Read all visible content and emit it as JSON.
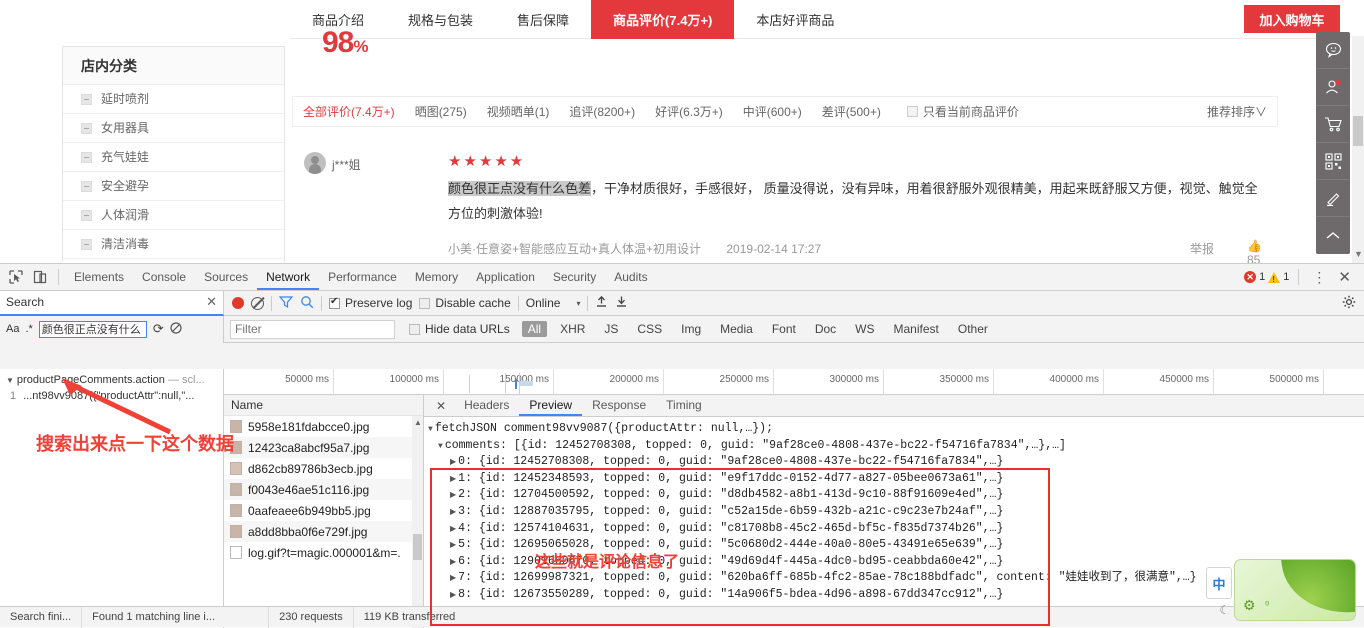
{
  "page": {
    "nav_tabs": [
      {
        "label": "商品介绍",
        "active": false
      },
      {
        "label": "规格与包装",
        "active": false
      },
      {
        "label": "售后保障",
        "active": false
      },
      {
        "label": "商品评价(7.4万+)",
        "active": true
      },
      {
        "label": "本店好评商品",
        "active": false
      }
    ],
    "cart_button": "加入购物车",
    "percent_value": "98",
    "percent_unit": "%",
    "category_box": {
      "title": "店内分类",
      "items": [
        "延时喷剂",
        "女用器具",
        "充气娃娃",
        "安全避孕",
        "人体润滑",
        "清洁消毒"
      ]
    },
    "review_filters": [
      {
        "label": "全部评价(7.4万+)",
        "active": true
      },
      {
        "label": "晒图(275)",
        "active": false
      },
      {
        "label": "视频晒单(1)",
        "active": false
      },
      {
        "label": "追评(8200+)",
        "active": false
      },
      {
        "label": "好评(6.3万+)",
        "active": false
      },
      {
        "label": "中评(600+)",
        "active": false
      },
      {
        "label": "差评(500+)",
        "active": false
      }
    ],
    "only_current_label": "只看当前商品评价",
    "sort_label": "推荐排序",
    "sort_caret": "∨",
    "review": {
      "username": "j***姐",
      "stars": "★★★★★",
      "highlight_text": "颜色很正点没有什么色差",
      "body_text": "，干净材质很好，手感很好， 质量没得说，没有异味，用着很舒服外观很精美，用起来既舒服又方便，视觉、触觉全方位的刺激体验!",
      "sku": "小美·任意姿+智能感应互动+真人体温+初用设计",
      "date": "2019-02-14 17:27",
      "report_label": "举报",
      "like_icon": "👍",
      "like_count": "85"
    },
    "side_toolbar_icons": [
      "chat-icon",
      "person-icon",
      "cart-icon",
      "qrcode-icon",
      "pen-icon",
      "scroll-top-icon"
    ]
  },
  "devtools": {
    "panel_tabs": [
      {
        "label": "Elements",
        "active": false
      },
      {
        "label": "Console",
        "active": false
      },
      {
        "label": "Sources",
        "active": false
      },
      {
        "label": "Network",
        "active": true
      },
      {
        "label": "Performance",
        "active": false
      },
      {
        "label": "Memory",
        "active": false
      },
      {
        "label": "Application",
        "active": false
      },
      {
        "label": "Security",
        "active": false
      },
      {
        "label": "Audits",
        "active": false
      }
    ],
    "error_count": "1",
    "warning_count": "1",
    "kebab": "⋮",
    "close": "✕",
    "search_panel": {
      "title": "Search",
      "close": "✕",
      "match_case_label": "Aa",
      "regex_label": ".*",
      "query_value": "颜色很正点没有什么",
      "refresh_icon": "⟳",
      "clear_icon": "clear-icon",
      "results_file": "productPageComments.action",
      "results_file_dim": "— scl...",
      "result_line_no": "1",
      "result_line_text": "...nt98vv9087({\"productAttr\":null,\"..."
    },
    "network_toolbar": {
      "preserve_log_label": "Preserve log",
      "preserve_log_checked": true,
      "disable_cache_label": "Disable cache",
      "disable_cache_checked": false,
      "throttle_value": "Online",
      "caret": "▾"
    },
    "filter_bar": {
      "filter_placeholder": "Filter",
      "filter_value": "",
      "hide_data_urls_label": "Hide data URLs",
      "hide_data_urls_checked": false,
      "types": [
        {
          "label": "All",
          "active": true
        },
        {
          "label": "XHR",
          "active": false
        },
        {
          "label": "JS",
          "active": false
        },
        {
          "label": "CSS",
          "active": false
        },
        {
          "label": "Img",
          "active": false
        },
        {
          "label": "Media",
          "active": false
        },
        {
          "label": "Font",
          "active": false
        },
        {
          "label": "Doc",
          "active": false
        },
        {
          "label": "WS",
          "active": false
        },
        {
          "label": "Manifest",
          "active": false
        },
        {
          "label": "Other",
          "active": false
        }
      ]
    },
    "timeline_ticks": [
      "50000 ms",
      "100000 ms",
      "150000 ms",
      "200000 ms",
      "250000 ms",
      "300000 ms",
      "350000 ms",
      "400000 ms",
      "450000 ms",
      "500000 ms"
    ],
    "request_list": {
      "header": "Name",
      "rows": [
        {
          "name": "5958e181fdabcce0.jpg",
          "kind": "img"
        },
        {
          "name": "12423ca8abcf95a7.jpg",
          "kind": "img"
        },
        {
          "name": "d862cb89786b3ecb.jpg",
          "kind": "img2"
        },
        {
          "name": "f0043e46ae51c116.jpg",
          "kind": "img"
        },
        {
          "name": "0aafeaee6b949bb5.jpg",
          "kind": "img"
        },
        {
          "name": "a8dd8bba0f6e729f.jpg",
          "kind": "img"
        },
        {
          "name": "log.gif?t=magic.000001&m=.",
          "kind": "doc"
        }
      ]
    },
    "detail_tabs": [
      {
        "label": "Headers",
        "active": false
      },
      {
        "label": "Preview",
        "active": true
      },
      {
        "label": "Response",
        "active": false
      },
      {
        "label": "Timing",
        "active": false
      }
    ],
    "detail_close": "✕",
    "preview_json": {
      "root": "fetchJSON comment98vv9087({productAttr: null,…});",
      "comments_line": "comments: [{id: 12452708308, topped: 0, guid: \"9af28ce0-4808-437e-bc22-f54716fa7834\",…},…]",
      "rows": [
        {
          "index": "0",
          "text": "{id: 12452708308, topped: 0, guid: \"9af28ce0-4808-437e-bc22-f54716fa7834\",…}"
        },
        {
          "index": "1",
          "text": "{id: 12452348593, topped: 0, guid: \"e9f17ddc-0152-4d77-a827-05bee0673a61\",…}"
        },
        {
          "index": "2",
          "text": "{id: 12704500592, topped: 0, guid: \"d8db4582-a8b1-413d-9c10-88f91609e4ed\",…}"
        },
        {
          "index": "3",
          "text": "{id: 12887035795, topped: 0, guid: \"c52a15de-6b59-432b-a21c-c9c23e7b24af\",…}"
        },
        {
          "index": "4",
          "text": "{id: 12574104631, topped: 0, guid: \"c81708b8-45c2-465d-bf5c-f835d7374b26\",…}"
        },
        {
          "index": "5",
          "text": "{id: 12695065028, topped: 0, guid: \"5c0680d2-444e-40a0-80e5-43491e65e639\",…}"
        },
        {
          "index": "6",
          "text": "{id: 12901660670, topped: 0, guid: \"49d69d4f-445a-4dc0-bd95-ceabbda60e42\",…}"
        },
        {
          "index": "7",
          "text": "{id: 12699987321, topped: 0, guid: \"620ba6ff-685b-4fc2-85ae-78c188bdfadc\", content: \"娃娃收到了，很满意\",…}"
        },
        {
          "index": "8",
          "text": "{id: 12673550289, topped: 0, guid: \"14a906f5-bdea-4d96-a898-67dd347cc912\",…}"
        }
      ]
    },
    "status_bar": {
      "search_status": "Search fini...",
      "search_found": "Found 1 matching line i...",
      "requests": "230 requests",
      "transferred": "119 KB transferred"
    }
  },
  "annotations": [
    {
      "text": "搜索出来点一下这个数据",
      "color": "#ef4136"
    },
    {
      "text": "这些就是评论信息了",
      "color": "#ef4136"
    }
  ],
  "ime": {
    "label": "中",
    "moon": "☾"
  },
  "colors": {
    "brand_red": "#e4393c",
    "devtools_blue": "#4285f4",
    "anno_red": "#ef4136"
  }
}
